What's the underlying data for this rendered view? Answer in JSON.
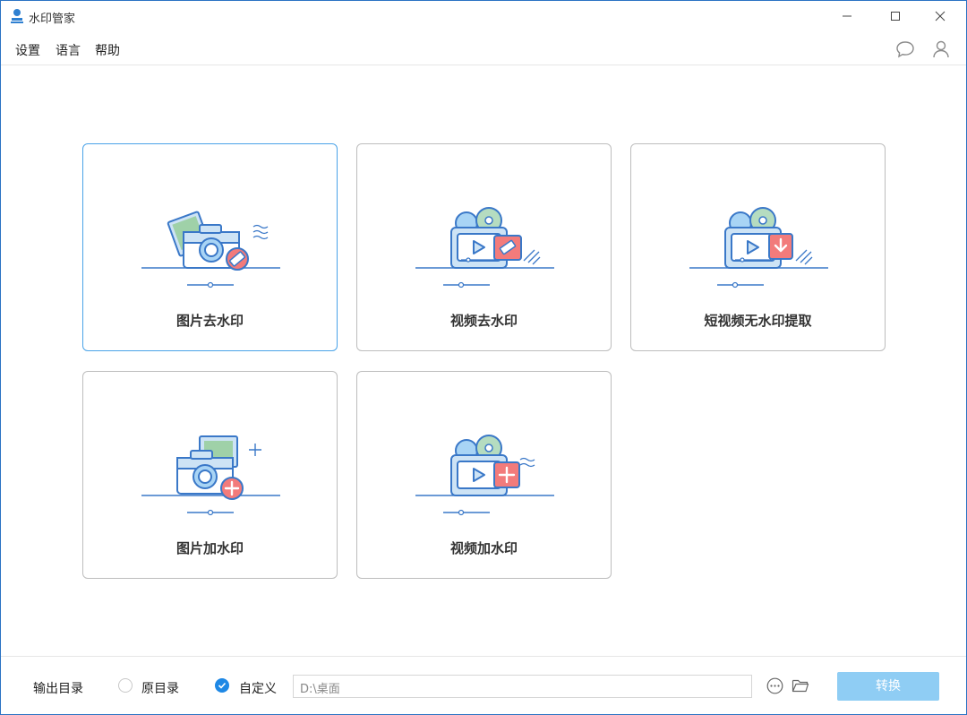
{
  "window": {
    "title": "水印管家"
  },
  "menu": {
    "settings": "设置",
    "language": "语言",
    "help": "帮助"
  },
  "cards": [
    {
      "label": "图片去水印"
    },
    {
      "label": "视频去水印"
    },
    {
      "label": "短视频无水印提取"
    },
    {
      "label": "图片加水印"
    },
    {
      "label": "视频加水印"
    }
  ],
  "footer": {
    "output_label": "输出目录",
    "option_original": "原目录",
    "option_custom": "自定义",
    "selected_option": "自定义",
    "path_value": "D:\\桌面",
    "convert_label": "转换"
  },
  "colors": {
    "accent": "#1e88e5",
    "convert_button": "#8fcdf4",
    "active_border": "#4aa3e8",
    "badge_red": "#f27b7b"
  }
}
